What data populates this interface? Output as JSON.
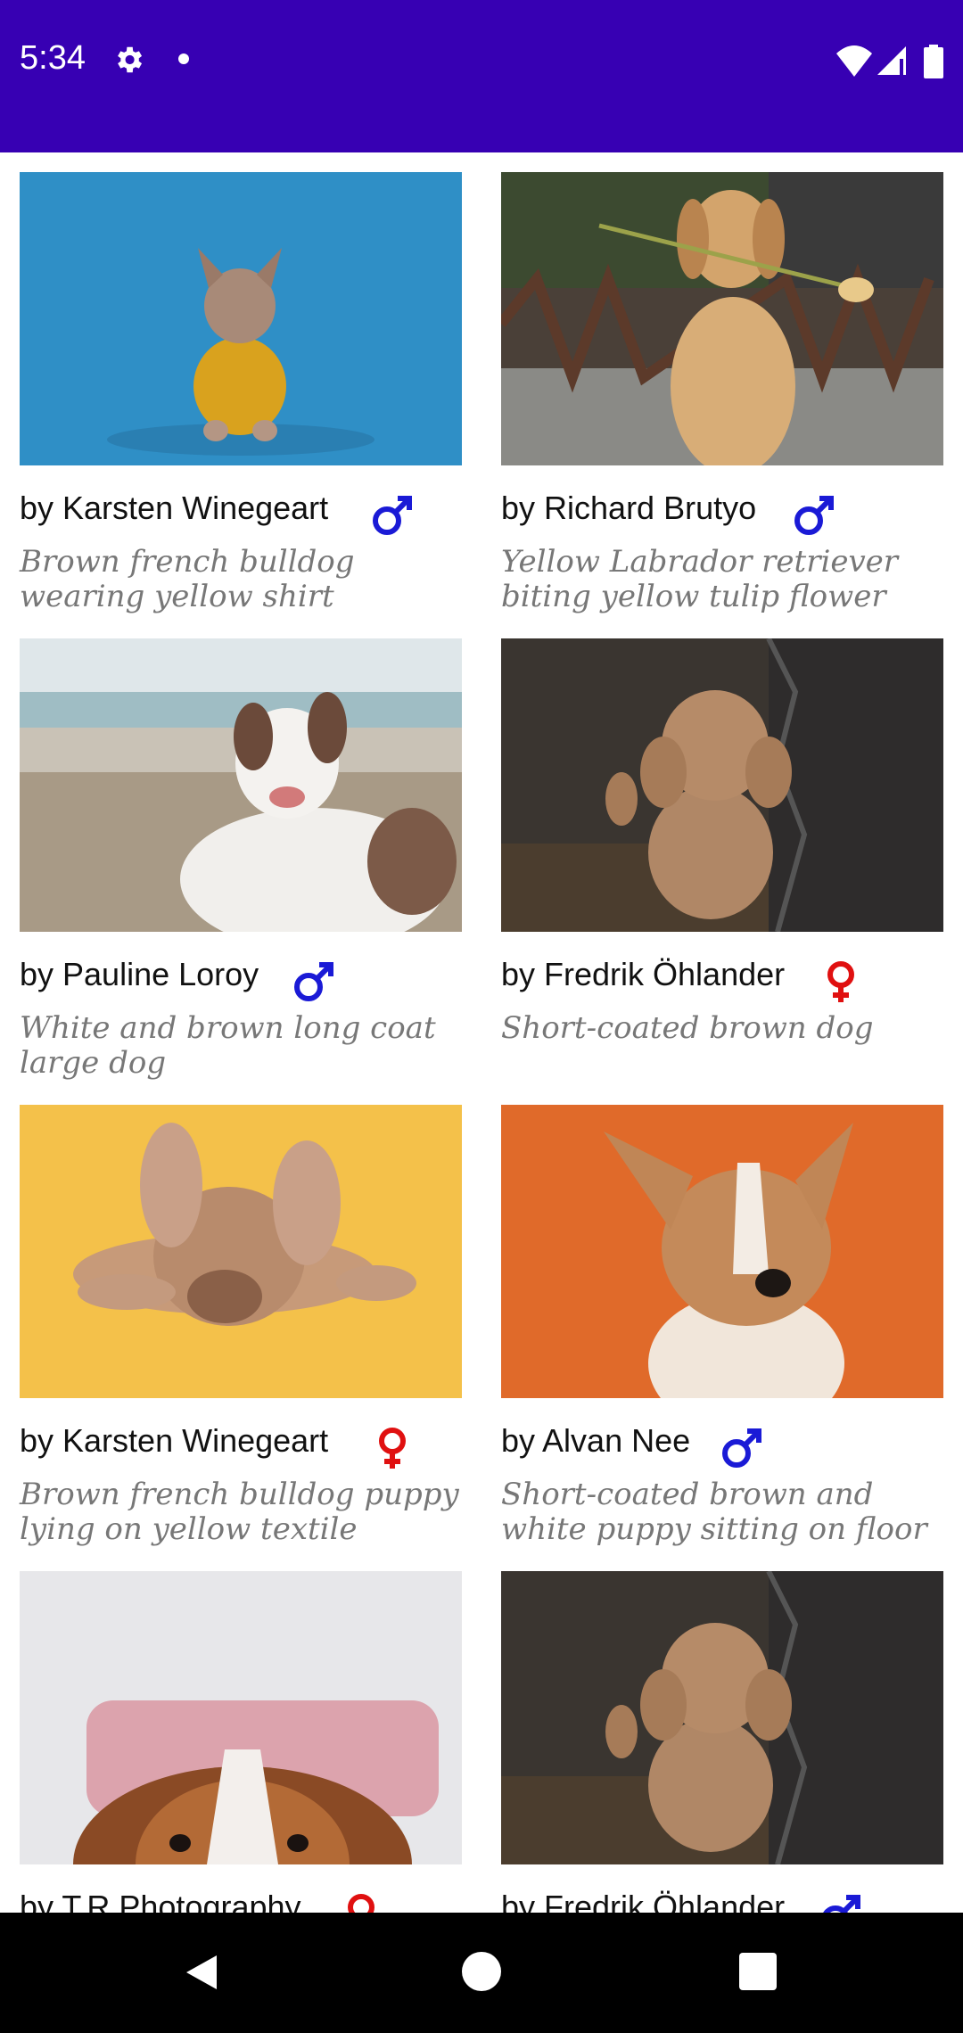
{
  "status_bar": {
    "time": "5:34",
    "icons": [
      "gear-icon",
      "notification-dot-icon",
      "wifi-icon",
      "cell-signal-icon",
      "battery-icon"
    ],
    "background": "#3700b3"
  },
  "colors": {
    "male": "#1a1ad6",
    "female": "#e01010",
    "author_text": "#111111",
    "desc_text": "#777777"
  },
  "dogs": [
    {
      "author": "by Karsten Winegeart",
      "gender": "male",
      "description": "Brown french bulldog wearing yellow shirt"
    },
    {
      "author": "by Richard Brutyo",
      "gender": "male",
      "description": "Yellow Labrador retriever biting yellow tulip flower"
    },
    {
      "author": "by Pauline Loroy",
      "gender": "male",
      "description": "White and brown long coat large dog"
    },
    {
      "author": "by Fredrik Öhlander",
      "gender": "female",
      "description": "Short-coated brown dog"
    },
    {
      "author": "by Karsten Winegeart",
      "gender": "female",
      "description": "Brown french bulldog puppy lying on yellow textile"
    },
    {
      "author": "by Alvan Nee",
      "gender": "male",
      "description": "Short-coated brown and white puppy sitting on floor"
    },
    {
      "author": "by T.R Photography",
      "gender": "female",
      "description": ""
    },
    {
      "author": "by Fredrik Öhlander",
      "gender": "male",
      "description": ""
    }
  ],
  "nav_bar": {
    "buttons": [
      "back-icon",
      "home-icon",
      "recents-icon"
    ]
  }
}
